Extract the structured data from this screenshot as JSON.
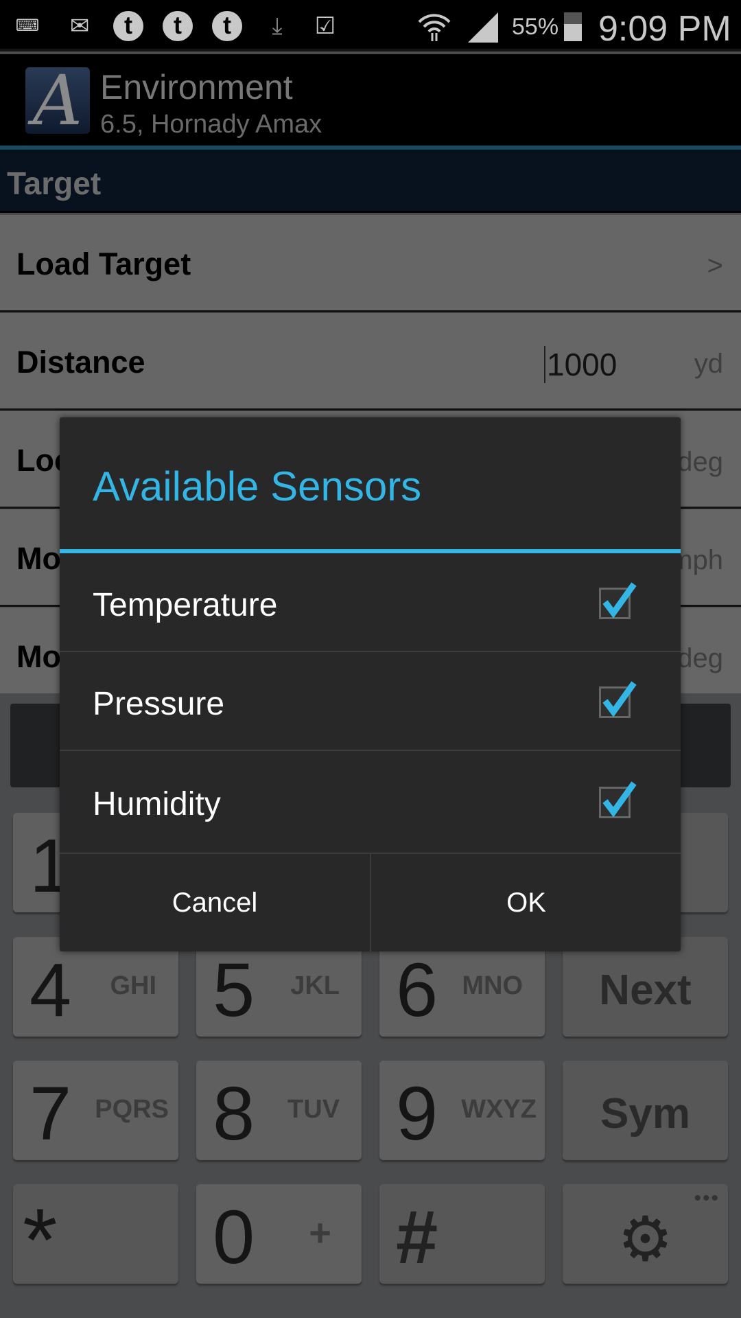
{
  "status_bar": {
    "battery": "55%",
    "time": "9:09 PM",
    "icons": [
      "keyboard-icon",
      "mail-icon",
      "tumblr-icon",
      "tumblr-icon",
      "tumblr-icon",
      "download-icon",
      "clipboard-check-icon",
      "wifi-icon",
      "signal-icon",
      "battery-icon"
    ]
  },
  "action_bar": {
    "title": "Environment",
    "subtitle": "6.5, Hornady Amax"
  },
  "section": {
    "title": "Target"
  },
  "rows": [
    {
      "label": "Load Target",
      "unit": ">"
    },
    {
      "label": "Distance",
      "value": "1000",
      "unit": "yd"
    },
    {
      "label": "Loc",
      "unit": "deg"
    },
    {
      "label": "Mo",
      "unit": "mph"
    },
    {
      "label": "Mo",
      "unit": "deg"
    }
  ],
  "keyboard": {
    "keys": [
      {
        "digit": "1"
      },
      {
        "digit": "4",
        "letters": "GHI"
      },
      {
        "digit": "5",
        "letters": "JKL"
      },
      {
        "digit": "6",
        "letters": "MNO"
      },
      {
        "label": "Next"
      },
      {
        "digit": "7",
        "letters": "PQRS"
      },
      {
        "digit": "8",
        "letters": "TUV"
      },
      {
        "digit": "9",
        "letters": "WXYZ"
      },
      {
        "label": "Sym"
      },
      {
        "digit": "*"
      },
      {
        "digit": "0",
        "letters": "+"
      },
      {
        "digit": "#"
      },
      {
        "icon": "gear-icon"
      }
    ]
  },
  "dialog": {
    "title": "Available Sensors",
    "accent": "#33b5e5",
    "items": [
      {
        "label": "Temperature",
        "checked": true
      },
      {
        "label": "Pressure",
        "checked": true
      },
      {
        "label": "Humidity",
        "checked": true
      }
    ],
    "cancel": "Cancel",
    "ok": "OK"
  }
}
